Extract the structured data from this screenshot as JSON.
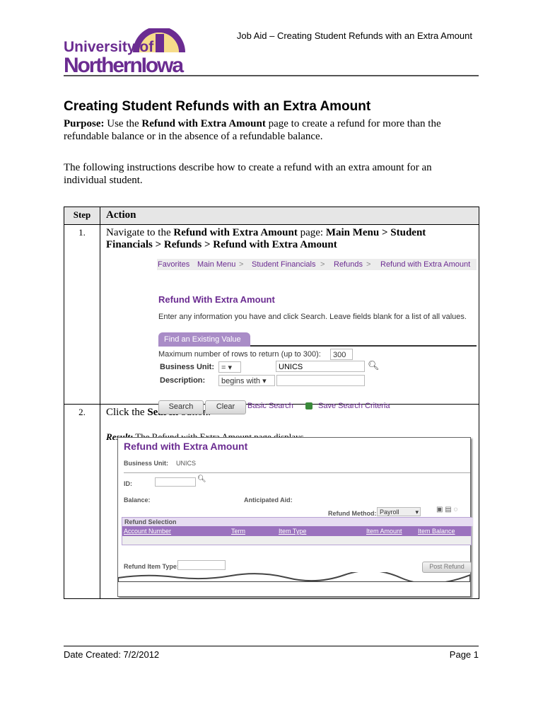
{
  "header": {
    "title": "Job Aid – Creating Student Refunds with an Extra Amount",
    "logo_text": [
      "University of",
      "NorthernIowa"
    ]
  },
  "doc": {
    "title": "Creating Student Refunds with an Extra Amount",
    "purpose_label": "Purpose:",
    "purpose_pre": "Use the ",
    "purpose_bold": "Refund with Extra Amount",
    "purpose_post": " page to create a refund for more than the refundable balance or in the absence of a refundable balance.",
    "instructions": "The following instructions describe how to create a refund with an extra amount for an individual student."
  },
  "table": {
    "col_step": "Step",
    "col_action": "Action",
    "rows": [
      {
        "step": "1.",
        "pre": "Navigate to the ",
        "bold1": "Refund with Extra Amount",
        "mid": " page:  ",
        "bold2": "Main Menu > Student Financials > Refunds > Refund with Extra Amount"
      },
      {
        "step": "2.",
        "pre": "Click the ",
        "bold1": "Search",
        "post": " button.",
        "result_label": "Result:",
        "result_text": "  The Refund with Extra Amount page displays."
      }
    ]
  },
  "shot1": {
    "nav": [
      "Favorites",
      "Main Menu",
      ">",
      "Student Financials",
      ">",
      "Refunds",
      ">",
      "Refund with Extra Amount"
    ],
    "title": "Refund With Extra Amount",
    "hint": "Enter any information you have and click Search. Leave fields blank for a list of all values.",
    "tab": "Find an Existing Value",
    "max_rows_label": "Maximum number of rows to return (up to 300):",
    "max_rows_value": "300",
    "bu_label": "Business Unit:",
    "bu_op": "=",
    "bu_value": "UNICS",
    "desc_label": "Description:",
    "desc_op": "begins with",
    "desc_value": "",
    "search": "Search",
    "clear": "Clear",
    "basic_search": "Basic Search",
    "save_criteria": "Save Search Criteria"
  },
  "shot2": {
    "title": "Refund with Extra Amount",
    "bu_label": "Business Unit:",
    "bu_value": "UNICS",
    "id_label": "ID:",
    "balance_label": "Balance:",
    "aid_label": "Anticipated Aid:",
    "method_label": "Refund Method:",
    "method_value": "Payroll",
    "grid_title": "Refund Selection",
    "columns": [
      "Account Number",
      "Term",
      "Item Type",
      "Item Amount",
      "Item Balance"
    ],
    "item_type_label": "Refund Item Type:",
    "post_refund": "Post Refund"
  },
  "footer": {
    "date": "Date Created: 7/2/2012",
    "page": "Page 1"
  },
  "colors": {
    "purple": "#6b2c91",
    "gold": "#f2c84b",
    "grid_header": "#9b72be"
  }
}
